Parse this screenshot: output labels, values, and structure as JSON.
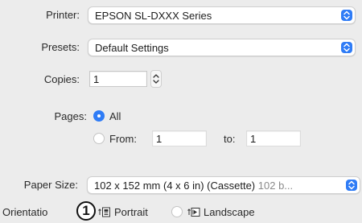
{
  "printer": {
    "label": "Printer:",
    "value": "EPSON SL-DXXX Series"
  },
  "presets": {
    "label": "Presets:",
    "value": "Default Settings"
  },
  "copies": {
    "label": "Copies:",
    "value": "1"
  },
  "pages": {
    "label": "Pages:",
    "all_label": "All",
    "from_label": "From:",
    "from_value": "1",
    "to_label": "to:",
    "to_value": "1",
    "selected": "All"
  },
  "paper_size": {
    "label": "Paper Size:",
    "value": "102 x 152 mm (4 x 6 in) (Cassette)",
    "value_dim": "102 b..."
  },
  "orientation": {
    "label": "Orientatio",
    "portrait_label": "Portrait",
    "landscape_label": "Landscape",
    "selected": "Portrait"
  },
  "callout": {
    "text": "1"
  },
  "colors": {
    "accent": "#2f7cf6",
    "background": "#ececec"
  }
}
